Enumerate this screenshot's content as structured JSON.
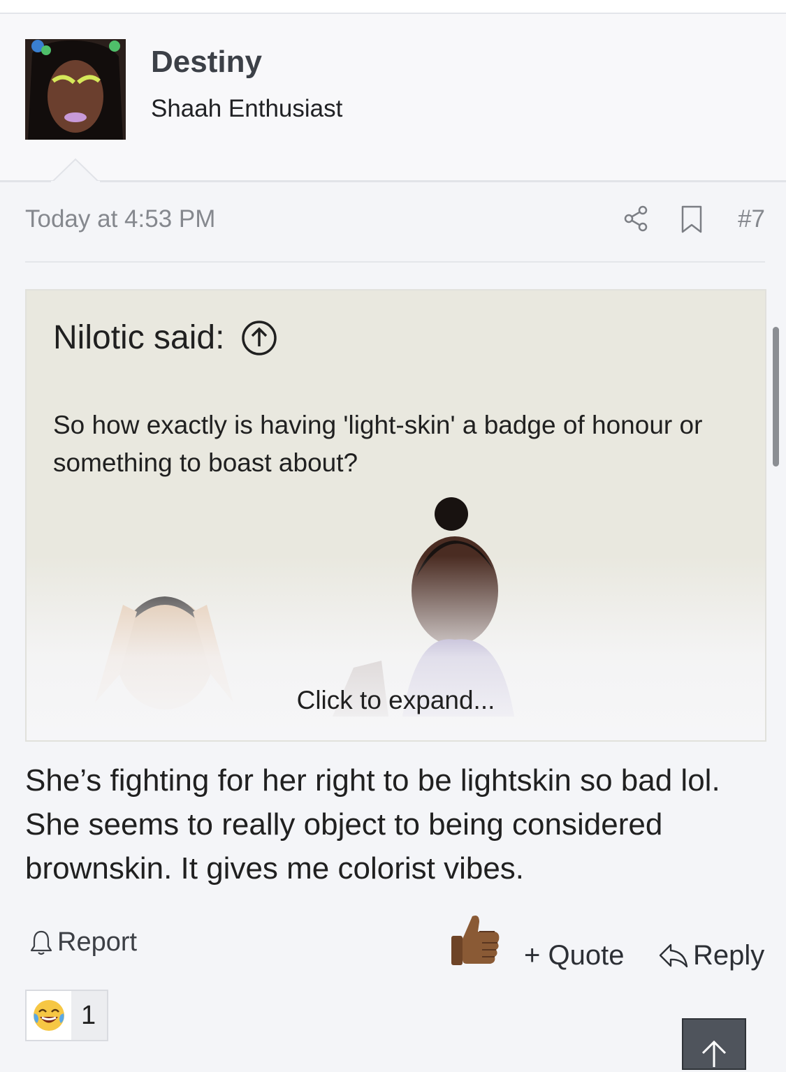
{
  "author": {
    "username": "Destiny",
    "user_title": "Shaah Enthusiast",
    "avatar_icon": "avatar"
  },
  "meta": {
    "timestamp": "Today at 4:53 PM",
    "post_number": "#7",
    "share_icon": "share-icon",
    "bookmark_icon": "bookmark-icon"
  },
  "quote": {
    "header": "Nilotic said:",
    "jump_icon": "arrow-up-circle-icon",
    "text": "So how exactly is having 'light-skin' a badge of honour or something to boast about?",
    "expand_label": "Click to expand..."
  },
  "post": {
    "body": "She’s fighting for her right to be lightskin so bad lol. She seems to really object to being considered brownskin. It gives me colorist vibes."
  },
  "actions": {
    "report_label": "Report",
    "quote_label": "+ Quote",
    "reply_label": "Reply",
    "like_icon": "thumbs-up-icon"
  },
  "reactions": [
    {
      "emoji": "😂",
      "count": "1"
    }
  ],
  "colors": {
    "background": "#f4f5f8",
    "quote_background": "#e9e8df",
    "username": "#3c4047",
    "muted_text": "#85888e"
  }
}
